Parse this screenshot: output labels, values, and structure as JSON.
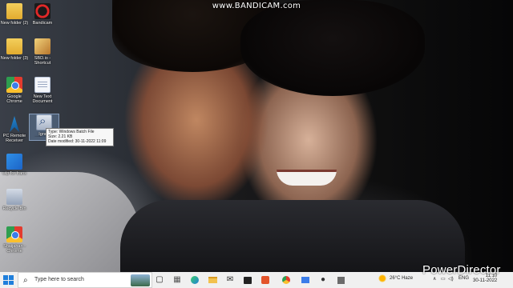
{
  "watermark": "www.BANDICAM.com",
  "overlay_brand": "PowerDirector",
  "desktop_icons": [
    {
      "name": "folder-1",
      "label": "New folder (2)"
    },
    {
      "name": "bandicam",
      "label": "Bandicam"
    },
    {
      "name": "folder-2",
      "label": "New folder (3)"
    },
    {
      "name": "games",
      "label": "SBD.io - Shortcut"
    },
    {
      "name": "chrome",
      "label": "Google Chrome"
    },
    {
      "name": "document",
      "label": "New Text Document"
    },
    {
      "name": "remote",
      "label": "PC Remote Receiver"
    },
    {
      "name": "zip",
      "label": "Ignez Windows Batch File"
    },
    {
      "name": "windows",
      "label": "wip for trans"
    },
    {
      "name": "recycle-bin",
      "label": "Recycle Bin"
    },
    {
      "name": "chrome-2",
      "label": "Shaijahan - Chrome"
    }
  ],
  "tooltip": {
    "line1": "Type: Windows Batch File",
    "line2": "Size: 2.21 KB",
    "line3": "Date modified: 30-11-2022 11:09"
  },
  "taskbar": {
    "search_placeholder": "Type here to search",
    "weather": "26°C  Haze",
    "language": "ENG",
    "date": "30-11-2022",
    "time": "11:10"
  }
}
